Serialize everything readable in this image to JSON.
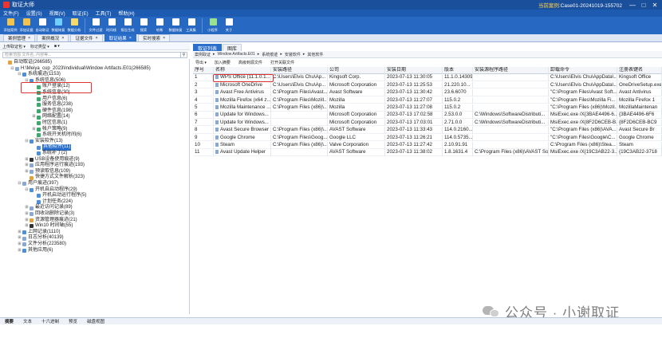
{
  "window": {
    "title": "取证大师",
    "case_label": "当前案例:",
    "case_name": "Case01-20241019-155702",
    "buttons": [
      "—",
      "□",
      "✕"
    ]
  },
  "menu": [
    "文件(F)",
    "设置(S)",
    "视图(V)",
    "取证(E)",
    "工具(T)",
    "帮助(H)"
  ],
  "ribbon": [
    {
      "label": "添加案例",
      "color": "#f3c34b"
    },
    {
      "label": "添加证据",
      "color": "#f3c34b"
    },
    {
      "label": "自动取证",
      "color": "#ffffff"
    },
    {
      "label": "数据恢复",
      "color": "#6fd0ff"
    },
    {
      "label": "数据分析",
      "color": "#f6d96b"
    },
    {
      "label": "文件过滤",
      "color": "#ffffff"
    },
    {
      "label": "时间线",
      "color": "#ffffff"
    },
    {
      "label": "报告生成",
      "color": "#ffffff"
    },
    {
      "label": "搜索",
      "color": "#ffffff"
    },
    {
      "label": "哈希",
      "color": "#ffffff"
    },
    {
      "label": "数据恢复",
      "color": "#ffffff"
    },
    {
      "label": "工具集",
      "color": "#ffffff"
    },
    {
      "label": "小程序",
      "color": "#9be28e"
    },
    {
      "label": "关于",
      "color": "#ffffff"
    }
  ],
  "doc_tabs": [
    {
      "label": "案例管理",
      "active": false
    },
    {
      "label": "案例概况",
      "active": false
    },
    {
      "label": "证据文件",
      "active": false
    },
    {
      "label": "取证结果",
      "active": true
    },
    {
      "label": "实时搜索",
      "active": false
    }
  ],
  "left_toolbar": [
    "上传取证包 ▾",
    "标记类型 ▾",
    "■ ▾"
  ],
  "left_search": {
    "placeholder": "检索范围  文件名, 内容等...",
    "button": "⚲"
  },
  "tree": [
    {
      "level": 0,
      "toggle": "",
      "label": "自动取证(266585)",
      "color": "#e2a13a"
    },
    {
      "level": 1,
      "toggle": "⊟",
      "label": "H:\\Meiya_cup_2023\\Individual\\Window Artifacts.E01(266585)",
      "color": "#8aa9d2"
    },
    {
      "level": 2,
      "toggle": "⊟",
      "label": "系统痕迹(1153)",
      "color": "#4d8fd8"
    },
    {
      "level": 3,
      "toggle": "⊟",
      "label": "系统信息(506)",
      "color": "#4d8fd8"
    },
    {
      "level": 4,
      "toggle": "",
      "label": "账户登录(12)",
      "color": "#3aa96b"
    },
    {
      "level": 4,
      "toggle": "",
      "label": "系统信息(30)",
      "color": "#3aa96b"
    },
    {
      "level": 4,
      "toggle": "",
      "label": "用户信息(6)",
      "color": "#3aa96b"
    },
    {
      "level": 4,
      "toggle": "",
      "label": "服务信息(238)",
      "color": "#3aa96b"
    },
    {
      "level": 4,
      "toggle": "",
      "label": "硬件信息(198)",
      "color": "#3aa96b"
    },
    {
      "level": 4,
      "toggle": "⊞",
      "label": "网络配置(14)",
      "color": "#3aa96b"
    },
    {
      "level": 4,
      "toggle": "",
      "label": "时区信息(1)",
      "color": "#3aa96b"
    },
    {
      "level": 4,
      "toggle": "⊞",
      "label": "帐户策略(9)",
      "color": "#3aa96b"
    },
    {
      "level": 4,
      "toggle": "",
      "label": "系统开关机时间(6)",
      "color": "#3aa96b"
    },
    {
      "level": 3,
      "toggle": "⊟",
      "label": "安装软件(13)",
      "color": "#4d8fd8"
    },
    {
      "level": 4,
      "toggle": "",
      "label": "其他软件(11)",
      "color": "#4d8fd8",
      "selected": true
    },
    {
      "level": 4,
      "toggle": "",
      "label": "系统补丁(2)",
      "color": "#4d8fd8"
    },
    {
      "level": 3,
      "toggle": "⊞",
      "label": "USB设备使用痕迹(9)",
      "color": "#333333"
    },
    {
      "level": 3,
      "toggle": "⊞",
      "label": "应用程序运行痕迹(193)",
      "color": "#8aa9d2"
    },
    {
      "level": 3,
      "toggle": "⊞",
      "label": "预读取信息(109)",
      "color": "#8aa9d2"
    },
    {
      "level": 3,
      "toggle": "",
      "label": "快捷方式文件解析(323)",
      "color": "#e2a13a"
    },
    {
      "level": 2,
      "toggle": "⊟",
      "label": "用户痕迹(397)",
      "color": "#8aa9d2"
    },
    {
      "level": 3,
      "toggle": "⊟",
      "label": "开机自启动程序(29)",
      "color": "#4d8fd8"
    },
    {
      "level": 4,
      "toggle": "",
      "label": "开机启动运行程序(5)",
      "color": "#4d8fd8"
    },
    {
      "level": 4,
      "toggle": "",
      "label": "计划任务(224)",
      "color": "#4d8fd8"
    },
    {
      "level": 3,
      "toggle": "⊞",
      "label": "最近访问记录(89)",
      "color": "#8aa9d2"
    },
    {
      "level": 3,
      "toggle": "⊞",
      "label": "回收站删除记录(3)",
      "color": "#8aa9d2"
    },
    {
      "level": 3,
      "toggle": "⊞",
      "label": "资源管理器痕迹(21)",
      "color": "#e2a13a"
    },
    {
      "level": 3,
      "toggle": "⊞",
      "label": "Win10 时间轴(55)",
      "color": "#333333"
    },
    {
      "level": 2,
      "toggle": "⊞",
      "label": "上网记录(1110)",
      "color": "#4d8fd8"
    },
    {
      "level": 2,
      "toggle": "⊞",
      "label": "日志分析(40139)",
      "color": "#8aa9d2"
    },
    {
      "level": 2,
      "toggle": "⊞",
      "label": "文件分析(223580)",
      "color": "#8aa9d2"
    },
    {
      "level": 2,
      "toggle": "⊞",
      "label": "其他应用(6)",
      "color": "#4d8fd8"
    }
  ],
  "right_tabs": [
    {
      "label": "取证列表",
      "active": true
    },
    {
      "label": "图库",
      "active": false
    }
  ],
  "breadcrumb": [
    "案例取证",
    "▸",
    "Window Artifacts.E01",
    "▸",
    "系统痕迹",
    "▸",
    "安装软件",
    "▸",
    "其他软件"
  ],
  "right_toolbar": [
    "导出 ▾",
    "加入摘要",
    "高级到源文件",
    "打开关联文件"
  ],
  "columns": [
    {
      "key": "no",
      "label": "序号",
      "w": 26
    },
    {
      "key": "name",
      "label": "名称",
      "w": 72
    },
    {
      "key": "path",
      "label": "安装路径",
      "w": 71
    },
    {
      "key": "company",
      "label": "公司",
      "w": 72
    },
    {
      "key": "date",
      "label": "安装日期",
      "w": 72
    },
    {
      "key": "version",
      "label": "版本",
      "w": 38
    },
    {
      "key": "source",
      "label": "安装源程序路径",
      "w": 95
    },
    {
      "key": "uninstall",
      "label": "卸载命令",
      "w": 86
    },
    {
      "key": "reg",
      "label": "注册表键名",
      "w": 56
    }
  ],
  "rows": [
    {
      "no": "1",
      "name": "WPS Office (11.1.0.1...",
      "path": "C:\\Users\\Elvis Chu\\Ap...",
      "company": "Kingsoft Corp.",
      "date": "2023-07-13 11:30:05",
      "version": "11.1.0.14309",
      "source": "",
      "uninstall": "C:\\Users\\Elvis Chu\\AppData\\...",
      "reg": "Kingsoft Office"
    },
    {
      "no": "2",
      "name": "Microsoft OneDrive",
      "path": "C:\\Users\\Elvis Chu\\Ap...",
      "company": "Microsoft Corporation",
      "date": "2023-07-13 11:25:53",
      "version": "21.220.10...",
      "source": "",
      "uninstall": "C:\\Users\\Elvis Chu\\AppData\\...",
      "reg": "OneDriveSetup.exe"
    },
    {
      "no": "3",
      "name": "Avast Free Antivirus",
      "path": "C:\\Program Files\\Avast...",
      "company": "Avast Software",
      "date": "2023-07-13 11:30:42",
      "version": "23.6.6070",
      "source": "",
      "uninstall": "\"C:\\Program Files\\Avast Soft...",
      "reg": "Avast Antivirus"
    },
    {
      "no": "4",
      "name": "Mozilla Firefox (x64 z...",
      "path": "C:\\Program Files\\Mozill...",
      "company": "Mozilla",
      "date": "2023-07-13 11:27:07",
      "version": "115.0.2",
      "source": "",
      "uninstall": "\"C:\\Program Files\\Mozilla Fi...",
      "reg": "Mozilla Firefox 1"
    },
    {
      "no": "5",
      "name": "Mozilla Maintenance ...",
      "path": "C:\\Program Files (x86)\\...",
      "company": "Mozilla",
      "date": "2023-07-13 11:27:08",
      "version": "115.0.2",
      "source": "",
      "uninstall": "\"C:\\Program Files (x86)\\Mozil...",
      "reg": "MozillaMaintenan"
    },
    {
      "no": "6",
      "name": "Update for Windows...",
      "path": "",
      "company": "Microsoft Corporation",
      "date": "2023-07-13 17:02:58",
      "version": "2.53.0.0",
      "source": "C:\\Windows\\SoftwareDistributi...",
      "uninstall": "MsiExec.exe /X{3BAE4496-6...",
      "reg": "{3BAE4496-6F6"
    },
    {
      "no": "7",
      "name": "Update for Windows...",
      "path": "",
      "company": "Microsoft Corporation",
      "date": "2023-07-13 17:03:01",
      "version": "2.71.0.0",
      "source": "C:\\Windows\\SoftwareDistributi...",
      "uninstall": "MsiExec.exe /X{8F2D6CEB-B...",
      "reg": "{8F2D6CEB-BC9"
    },
    {
      "no": "8",
      "name": "Avast Secure Browser",
      "path": "C:\\Program Files (x86)\\...",
      "company": "AVAST Software",
      "date": "2023-07-13 11:33:43",
      "version": "114.0.2160...",
      "source": "",
      "uninstall": "\"C:\\Program Files (x86)\\AVA...",
      "reg": "Avast Secure Br"
    },
    {
      "no": "9",
      "name": "Google Chrome",
      "path": "C:\\Program Files\\Goog...",
      "company": "Google LLC",
      "date": "2023-07-13 11:26:21",
      "version": "114.0.5735...",
      "source": "",
      "uninstall": "\"C:\\Program Files\\Google\\C...",
      "reg": "Google Chrome"
    },
    {
      "no": "10",
      "name": "Steam",
      "path": "C:\\Program Files (x86)\\...",
      "company": "Valve Corporation",
      "date": "2023-07-13 11:27:42",
      "version": "2.10.91.91",
      "source": "",
      "uninstall": "C:\\Program Files (x86)\\Stea...",
      "reg": "Steam"
    },
    {
      "no": "11",
      "name": "Avast Update Helper",
      "path": "",
      "company": "AVAST Software",
      "date": "2023-07-13 11:38:02",
      "version": "1.8.1631.4",
      "source": "C:\\Program Files (x86)\\AVAST So...",
      "uninstall": "MsiExec.exe /X{19C3AB22-3...",
      "reg": "{19C3AB22-3718"
    }
  ],
  "bottom_tabs": [
    {
      "label": "摘要",
      "active": true
    },
    {
      "label": "文本",
      "active": false
    },
    {
      "label": "十六进制",
      "active": false
    },
    {
      "label": "预览",
      "active": false
    },
    {
      "label": "磁盘视图",
      "active": false
    }
  ],
  "watermark": "公众号 · 小谢取证"
}
